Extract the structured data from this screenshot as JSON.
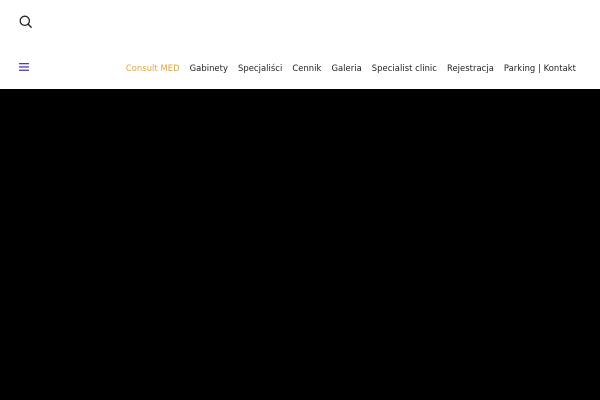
{
  "header": {
    "search_icon": "search-icon",
    "menu_icon": "hamburger-menu-icon",
    "menu_icon_color": "#4b3fa8"
  },
  "nav": {
    "active_color": "#e0a33f",
    "text_color": "#222222",
    "items": [
      {
        "label": "Consult MED",
        "active": true
      },
      {
        "label": "Gabinety",
        "active": false
      },
      {
        "label": "Specjaliści",
        "active": false
      },
      {
        "label": "Cennik",
        "active": false
      },
      {
        "label": "Galeria",
        "active": false
      },
      {
        "label": "Specialist clinic",
        "active": false
      },
      {
        "label": "Rejestracja",
        "active": false
      },
      {
        "label": "Parking | Kontakt",
        "active": false
      }
    ]
  },
  "hero": {
    "background": "#000000"
  }
}
